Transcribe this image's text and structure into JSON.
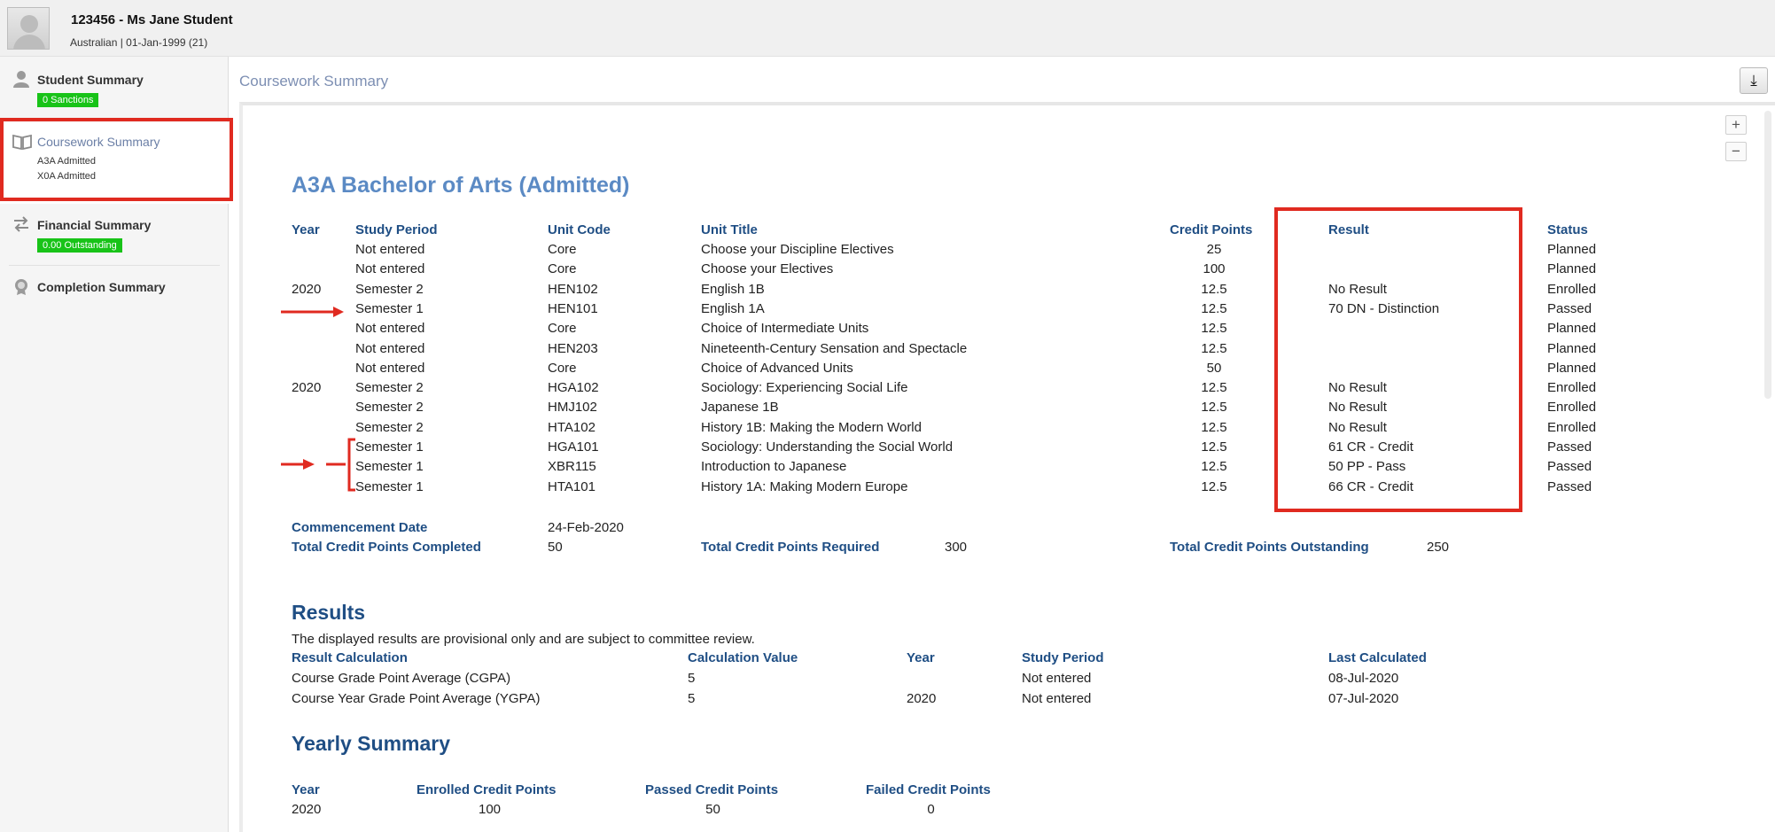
{
  "header": {
    "student_name": "123456 - Ms Jane Student",
    "student_meta": "Australian | 01-Jan-1999 (21)"
  },
  "sidebar": {
    "items": [
      {
        "title": "Student Summary",
        "badge": "0 Sanctions",
        "icon": "person-icon"
      },
      {
        "title": "Coursework Summary",
        "subs": [
          "A3A Admitted",
          "X0A Admitted"
        ],
        "icon": "book-icon"
      },
      {
        "title": "Financial Summary",
        "badge": "0.00 Outstanding",
        "icon": "transfer-icon"
      },
      {
        "title": "Completion Summary",
        "icon": "medal-icon"
      }
    ]
  },
  "main": {
    "page_title": "Coursework Summary",
    "download_icon": "⤓",
    "zoom_in": "+",
    "zoom_out": "−"
  },
  "program": {
    "heading": "A3A Bachelor of Arts (Admitted)",
    "columns": {
      "year": "Year",
      "study_period": "Study Period",
      "unit_code": "Unit Code",
      "unit_title": "Unit Title",
      "credit_points": "Credit Points",
      "result": "Result",
      "status": "Status"
    },
    "rows": [
      {
        "year": "",
        "period": "Not entered",
        "code": "Core",
        "title": "Choose your Discipline Electives",
        "cp": "25",
        "result": "",
        "status": "Planned"
      },
      {
        "year": "",
        "period": "Not entered",
        "code": "Core",
        "title": "Choose your Electives",
        "cp": "100",
        "result": "",
        "status": "Planned"
      },
      {
        "year": "2020",
        "period": "Semester 2",
        "code": "HEN102",
        "title": "English 1B",
        "cp": "12.5",
        "result": "No Result",
        "status": "Enrolled"
      },
      {
        "year": "",
        "period": "Semester 1",
        "code": "HEN101",
        "title": "English 1A",
        "cp": "12.5",
        "result": "70 DN - Distinction",
        "status": "Passed"
      },
      {
        "year": "",
        "period": "Not entered",
        "code": "Core",
        "title": "Choice of Intermediate Units",
        "cp": "12.5",
        "result": "",
        "status": "Planned"
      },
      {
        "year": "",
        "period": "Not entered",
        "code": "HEN203",
        "title": "Nineteenth-Century Sensation and Spectacle",
        "cp": "12.5",
        "result": "",
        "status": "Planned"
      },
      {
        "year": "",
        "period": "Not entered",
        "code": "Core",
        "title": "Choice of Advanced Units",
        "cp": "50",
        "result": "",
        "status": "Planned"
      },
      {
        "year": "2020",
        "period": "Semester 2",
        "code": "HGA102",
        "title": "Sociology: Experiencing Social Life",
        "cp": "12.5",
        "result": "No Result",
        "status": "Enrolled"
      },
      {
        "year": "",
        "period": "Semester 2",
        "code": "HMJ102",
        "title": "Japanese 1B",
        "cp": "12.5",
        "result": "No Result",
        "status": "Enrolled"
      },
      {
        "year": "",
        "period": "Semester 2",
        "code": "HTA102",
        "title": "History 1B: Making the Modern World",
        "cp": "12.5",
        "result": "No Result",
        "status": "Enrolled"
      },
      {
        "year": "",
        "period": "Semester 1",
        "code": "HGA101",
        "title": "Sociology: Understanding the Social World",
        "cp": "12.5",
        "result": "61 CR - Credit",
        "status": "Passed"
      },
      {
        "year": "",
        "period": "Semester 1",
        "code": "XBR115",
        "title": "Introduction to Japanese",
        "cp": "12.5",
        "result": "50 PP - Pass",
        "status": "Passed"
      },
      {
        "year": "",
        "period": "Semester 1",
        "code": "HTA101",
        "title": "History 1A: Making Modern Europe",
        "cp": "12.5",
        "result": "66 CR - Credit",
        "status": "Passed"
      }
    ],
    "commencement_label": "Commencement Date",
    "commencement_value": "24-Feb-2020",
    "tcp_completed_label": "Total Credit Points Completed",
    "tcp_completed_value": "50",
    "tcp_required_label": "Total Credit Points Required",
    "tcp_required_value": "300",
    "tcp_outstanding_label": "Total Credit Points Outstanding",
    "tcp_outstanding_value": "250"
  },
  "results": {
    "heading": "Results",
    "note": "The displayed results are provisional only and are subject to committee review.",
    "columns": {
      "calc": "Result Calculation",
      "value": "Calculation Value",
      "year": "Year",
      "period": "Study Period",
      "last": "Last Calculated"
    },
    "rows": [
      {
        "calc": "Course Grade Point Average (CGPA)",
        "value": "5",
        "year": "",
        "period": "Not entered",
        "last": "08-Jul-2020"
      },
      {
        "calc": "Course Year Grade Point Average (YGPA)",
        "value": "5",
        "year": "2020",
        "period": "Not entered",
        "last": "07-Jul-2020"
      }
    ]
  },
  "yearly": {
    "heading": "Yearly Summary",
    "columns": {
      "year": "Year",
      "enrolled": "Enrolled Credit Points",
      "passed": "Passed Credit Points",
      "failed": "Failed Credit Points"
    },
    "rows": [
      {
        "year": "2020",
        "enrolled": "100",
        "passed": "50",
        "failed": "0"
      }
    ]
  },
  "colors": {
    "accent_red": "#e02a20",
    "heading_blue": "#1f4e84",
    "badge_green": "#18c318"
  }
}
